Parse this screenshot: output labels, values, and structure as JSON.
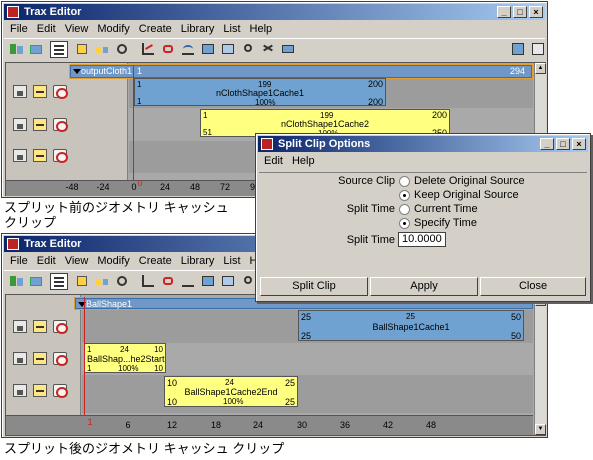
{
  "top_window": {
    "title": "Trax Editor",
    "menus": [
      "File",
      "Edit",
      "View",
      "Modify",
      "Create",
      "Library",
      "List",
      "Help"
    ],
    "header_track": {
      "name": "outputCloth1",
      "start": "1",
      "end": "294"
    },
    "clips": [
      {
        "name": "nCloth​Shape1Cache1",
        "top_left": "1",
        "top_mid": "199",
        "top_right": "200",
        "bot_left": "1",
        "bot_mid": "100%",
        "bot_right": "200"
      },
      {
        "name": "nClothShape1Cache2",
        "top_left": "1",
        "top_mid": "199",
        "top_right": "200",
        "bot_left": "51",
        "bot_mid": "100%",
        "bot_right": "250"
      }
    ],
    "ruler": [
      "-48",
      "-24",
      "0",
      "24",
      "48",
      "72",
      "96"
    ],
    "ruler_marker": "0"
  },
  "caption_top": [
    "スプリット前のジオメトリ キャッシュ",
    "クリップ"
  ],
  "bottom_window": {
    "title": "Trax Editor",
    "menus": [
      "File",
      "Edit",
      "View",
      "Modify",
      "Create",
      "Library",
      "List",
      "Help"
    ],
    "header_track": {
      "name": "BallShape1"
    },
    "clips": [
      {
        "name": "BallShape1Cache1",
        "top_left": "25",
        "top_mid": "25",
        "top_right": "50",
        "bot_left": "25",
        "bot_mid": "",
        "bot_right": "50"
      },
      {
        "name": "BallShap...he2Start",
        "top_left": "1",
        "top_mid": "24",
        "top_right": "10",
        "bot_left": "1",
        "bot_mid": "100%",
        "bot_right": "10"
      },
      {
        "name": "BallShape1Cache2End",
        "top_left": "10",
        "top_mid": "24",
        "top_right": "25",
        "bot_left": "10",
        "bot_mid": "100%",
        "bot_right": "25"
      }
    ],
    "ruler": [
      "1",
      "6",
      "12",
      "18",
      "24",
      "30",
      "36",
      "42",
      "48"
    ]
  },
  "caption_bottom": "スプリット後のジオメトリ キャッシュ クリップ",
  "dialog": {
    "title": "Split Clip Options",
    "menus": [
      "Edit",
      "Help"
    ],
    "source_clip_label": "Source Clip",
    "source_options": [
      "Delete Original Source",
      "Keep Original Source"
    ],
    "split_time_label": "Split Time",
    "split_time_options": [
      "Current Time",
      "Specify Time"
    ],
    "split_time_field_label": "Split Time",
    "split_time_value": "10.0000",
    "buttons": [
      "Split Clip",
      "Apply",
      "Close"
    ]
  }
}
